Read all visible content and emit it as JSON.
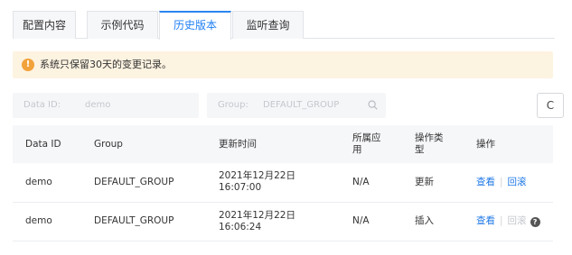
{
  "tabs": [
    {
      "label": "配置内容",
      "active": false
    },
    {
      "label": "示例代码",
      "active": false
    },
    {
      "label": "历史版本",
      "active": true
    },
    {
      "label": "监听查询",
      "active": false
    }
  ],
  "alert": {
    "icon": "warning-icon",
    "text": "系统只保留30天的变更记录。"
  },
  "filters": {
    "data_id": {
      "label": "Data ID:",
      "value": "demo"
    },
    "group": {
      "label": "Group:",
      "value": "DEFAULT_GROUP"
    },
    "refresh_icon": "refresh-icon"
  },
  "table": {
    "columns": [
      "Data ID",
      "Group",
      "更新时间",
      "所属应用",
      "操作类型",
      "操作"
    ],
    "rows": [
      {
        "data_id": "demo",
        "group": "DEFAULT_GROUP",
        "date": "2021年12月22日",
        "time": "16:07:00",
        "app": "N/A",
        "op_type": "更新",
        "view": "查看",
        "rollback": "回滚",
        "rollback_enabled": true
      },
      {
        "data_id": "demo",
        "group": "DEFAULT_GROUP",
        "date": "2021年12月22日",
        "time": "16:06:24",
        "app": "N/A",
        "op_type": "插入",
        "view": "查看",
        "rollback": "回滚",
        "rollback_enabled": false
      }
    ]
  },
  "colors": {
    "accent": "#1f7ff4",
    "warning": "#f2a23a",
    "alert_bg": "#fdf3e1"
  }
}
